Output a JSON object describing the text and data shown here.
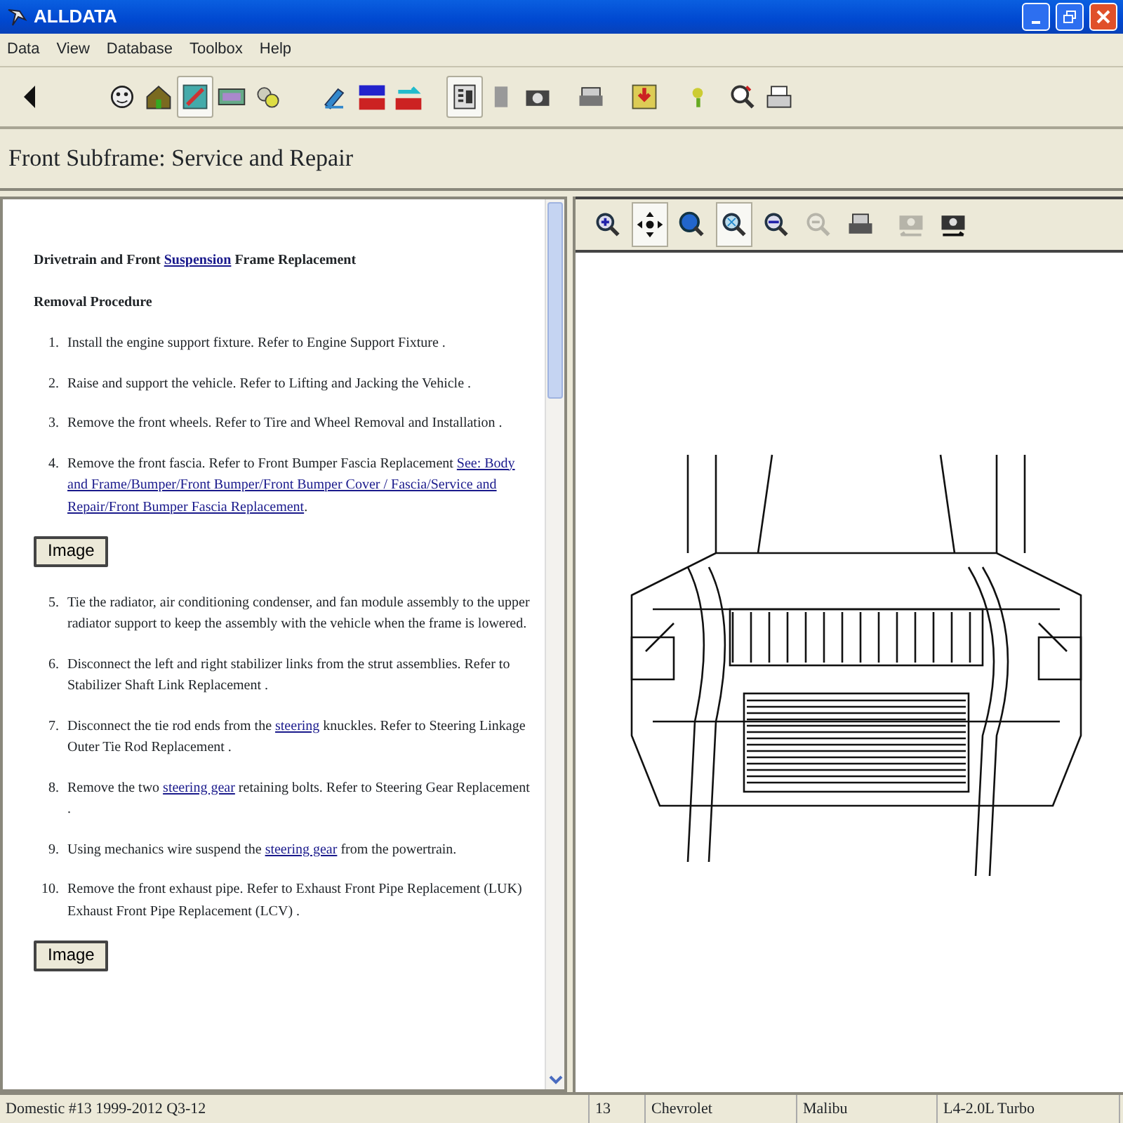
{
  "window": {
    "title": "ALLDATA"
  },
  "menu": [
    "Data",
    "View",
    "Database",
    "Toolbox",
    "Help"
  ],
  "toolbar": [
    {
      "pressed": false
    },
    {
      "pressed": false
    },
    {
      "pressed": false
    },
    {
      "pressed": true
    },
    {
      "pressed": false
    },
    {
      "pressed": false
    },
    {
      "pressed": false
    },
    {
      "pressed": false
    },
    {
      "pressed": false
    },
    {
      "pressed": true
    },
    {
      "pressed": false
    },
    {
      "pressed": false
    },
    {
      "pressed": false
    },
    {
      "pressed": false
    },
    {
      "pressed": false
    },
    {
      "pressed": false
    },
    {
      "pressed": false
    }
  ],
  "page_title": "Front Subframe:  Service and Repair",
  "document": {
    "heading": [
      {
        "text": "Drivetrain and Front ",
        "link": false
      },
      {
        "text": "Suspension",
        "link": true
      },
      {
        "text": " Frame Replacement",
        "link": false
      }
    ],
    "subheading": "Removal Procedure",
    "steps": [
      {
        "number": "1.",
        "parts": [
          {
            "text": "Install the engine support fixture. Refer to Engine Support Fixture .",
            "link": false
          }
        ]
      },
      {
        "number": "2.",
        "parts": [
          {
            "text": "Raise and support the vehicle. Refer to Lifting and Jacking the Vehicle .",
            "link": false
          }
        ]
      },
      {
        "number": "3.",
        "parts": [
          {
            "text": "Remove the front wheels. Refer to Tire and Wheel Removal and Installation .",
            "link": false
          }
        ]
      },
      {
        "number": "4.",
        "parts": [
          {
            "text": "Remove the front fascia. Refer to Front Bumper Fascia Replacement ",
            "link": false
          },
          {
            "text": "See: Body",
            "link": true
          },
          {
            "text": "and Frame/Bumper/Front Bumper/Front Bumper Cover / Fascia/Service and",
            "link": true
          },
          {
            "text": "Repair/Front Bumper Fascia Replacement",
            "link": true
          },
          {
            "text": ".",
            "link": false
          }
        ],
        "image_button": "Image"
      },
      {
        "number": "5.",
        "parts": [
          {
            "text": "Tie the radiator, air conditioning condenser, and fan module assembly to the upper radiator support to keep the assembly with the vehicle when the frame is lowered.",
            "link": false
          }
        ]
      },
      {
        "number": "6.",
        "parts": [
          {
            "text": "Disconnect the left and right stabilizer links from the strut assemblies. Refer to Stabilizer Shaft Link Replacement .",
            "link": false
          }
        ]
      },
      {
        "number": "7.",
        "parts": [
          {
            "text": "Disconnect the tie rod ends from the ",
            "link": false
          },
          {
            "text": "steering",
            "link": true
          },
          {
            "text": " knuckles. Refer to Steering Linkage Outer Tie Rod Replacement .",
            "link": false
          }
        ]
      },
      {
        "number": "8.",
        "parts": [
          {
            "text": "Remove the two ",
            "link": false
          },
          {
            "text": "steering gear",
            "link": true
          },
          {
            "text": " retaining bolts. Refer to Steering Gear Replacement .",
            "link": false
          }
        ]
      },
      {
        "number": "9.",
        "parts": [
          {
            "text": "Using mechanics wire suspend the ",
            "link": false
          },
          {
            "text": "steering gear",
            "link": true
          },
          {
            "text": " from the powertrain.",
            "link": false
          }
        ]
      },
      {
        "number": "10.",
        "parts": [
          {
            "text": "Remove the front exhaust pipe. Refer to Exhaust Front Pipe Replacement (LUK) Exhaust Front Pipe Replacement (LCV) .",
            "link": false
          }
        ],
        "image_button": "Image"
      }
    ]
  },
  "image_toolbar": [
    {
      "pressed": false,
      "disabled": false
    },
    {
      "pressed": true,
      "disabled": false
    },
    {
      "pressed": false,
      "disabled": false
    },
    {
      "pressed": true,
      "disabled": false
    },
    {
      "pressed": false,
      "disabled": false
    },
    {
      "pressed": false,
      "disabled": true
    },
    {
      "pressed": false,
      "disabled": false
    },
    {
      "pressed": false,
      "disabled": true
    },
    {
      "pressed": false,
      "disabled": false
    }
  ],
  "status_bar": [
    "Domestic #13 1999-2012 Q3-12",
    "13",
    "Chevrolet",
    "Malibu",
    "L4-2.0L Turbo"
  ]
}
